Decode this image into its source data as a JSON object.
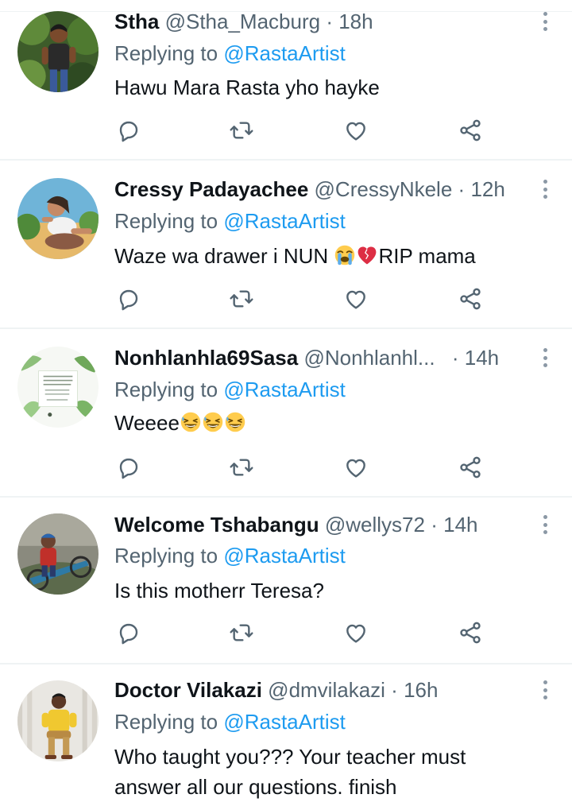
{
  "tweets": [
    {
      "name": "Stha",
      "handle": "@Stha_Macburg",
      "separator": "·",
      "time": "18h",
      "replying_prefix": "Replying to",
      "replying_to": "@RastaArtist",
      "text": "Hawu Mara Rasta yho hayke"
    },
    {
      "name": "Cressy Padayachee",
      "handle": "@CressyNkele",
      "separator": "·",
      "time": "12h",
      "replying_prefix": "Replying to",
      "replying_to": "@RastaArtist",
      "text_before": "Waze wa drawer i NUN ",
      "text_after": "RIP mama",
      "emojis": [
        "loudly-crying-face",
        "broken-heart"
      ]
    },
    {
      "name": "Nonhlanhla69Sasa",
      "handle": "@Nonhlanhl...",
      "separator": "·",
      "time": "14h",
      "replying_prefix": "Replying to",
      "replying_to": "@RastaArtist",
      "text_before": "Weeee",
      "emojis": [
        "grinning-sweat-face",
        "grinning-sweat-face",
        "grinning-sweat-face"
      ]
    },
    {
      "name": "Welcome Tshabangu",
      "handle": "@wellys72",
      "separator": "·",
      "time": "14h",
      "replying_prefix": "Replying to",
      "replying_to": "@RastaArtist",
      "text": "Is this motherr Teresa?"
    },
    {
      "name": "Doctor Vilakazi",
      "handle": "@dmvilakazi",
      "separator": "·",
      "time": "16h",
      "replying_prefix": "Replying to",
      "replying_to": "@RastaArtist",
      "text_line1": "Who taught you??? Your teacher must",
      "text_line2": "answer all our questions. finish"
    }
  ],
  "action_icons": [
    "reply-icon",
    "retweet-icon",
    "like-icon",
    "share-icon"
  ],
  "colors": {
    "link": "#1d9bf0",
    "secondary_text": "#536471",
    "primary_text": "#0f1419",
    "divider": "#eff3f4"
  }
}
